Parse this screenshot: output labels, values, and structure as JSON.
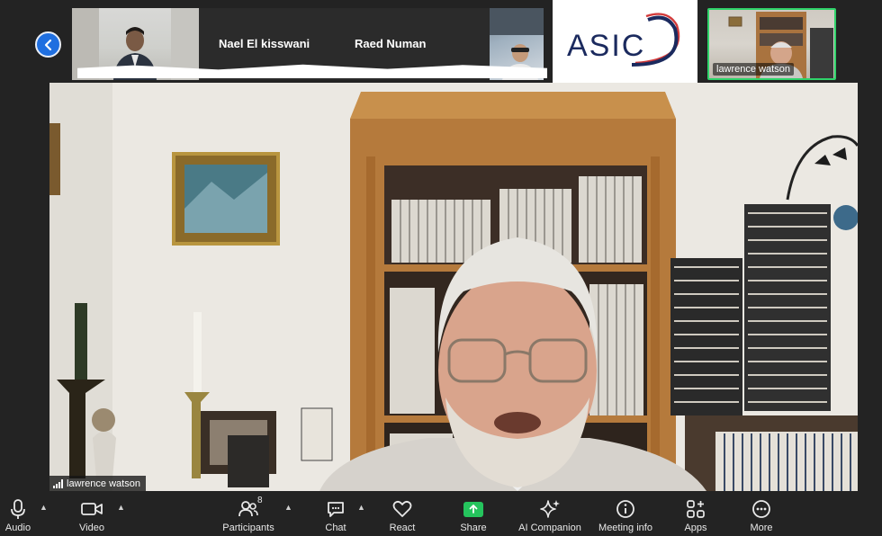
{
  "participants_strip": {
    "names": [
      "Nael El kisswani",
      "Raed Numan"
    ],
    "self_label": "lawrence watson"
  },
  "logo": {
    "text": "ASIC"
  },
  "main_video": {
    "speaker_label": "lawrence watson"
  },
  "toolbar": {
    "audio": "Audio",
    "video": "Video",
    "participants": "Participants",
    "participants_count": "8",
    "chat": "Chat",
    "react": "React",
    "share": "Share",
    "ai_companion": "AI Companion",
    "meeting_info": "Meeting info",
    "apps": "Apps",
    "more": "More"
  },
  "colors": {
    "background": "#232323",
    "share_accent": "#25c45d",
    "active_speaker_border": "#2fd36a",
    "back_button": "#1f6fe0",
    "logo_navy": "#1b2a5e",
    "logo_red": "#d23a3a"
  }
}
